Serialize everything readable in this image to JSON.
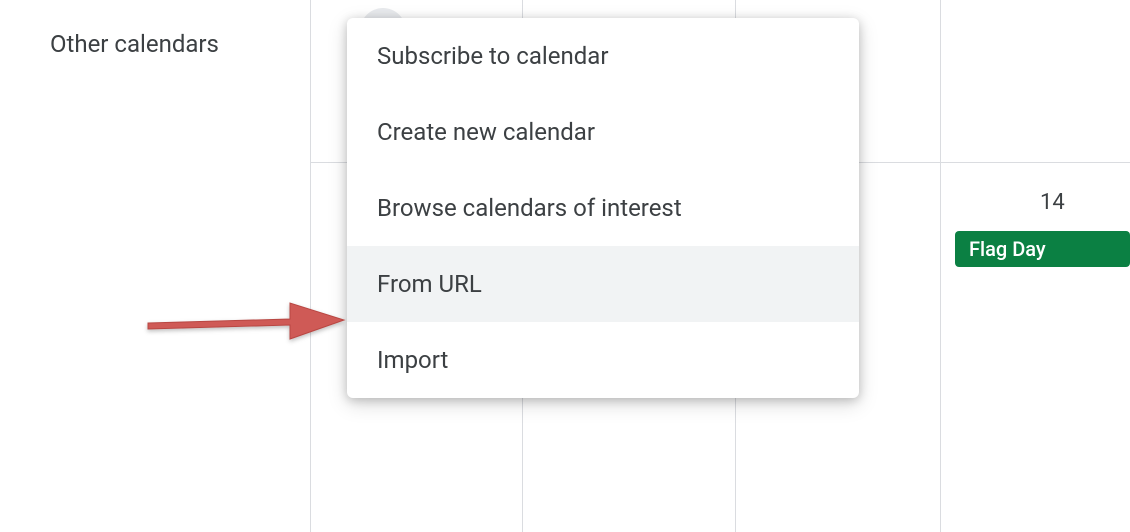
{
  "sidebar": {
    "section_label": "Other calendars"
  },
  "menu": {
    "items": [
      {
        "label": "Subscribe to calendar",
        "hover": false
      },
      {
        "label": "Create new calendar",
        "hover": false
      },
      {
        "label": "Browse calendars of interest",
        "hover": false
      },
      {
        "label": "From URL",
        "hover": true
      },
      {
        "label": "Import",
        "hover": false
      }
    ]
  },
  "calendar": {
    "day_number": "14",
    "event_label": "Flag Day"
  },
  "colors": {
    "event_green": "#0b8043",
    "menu_hover": "#f1f3f4",
    "grid_line": "#dadce0",
    "text": "#3c4043",
    "arrow": "#cf5a56"
  }
}
